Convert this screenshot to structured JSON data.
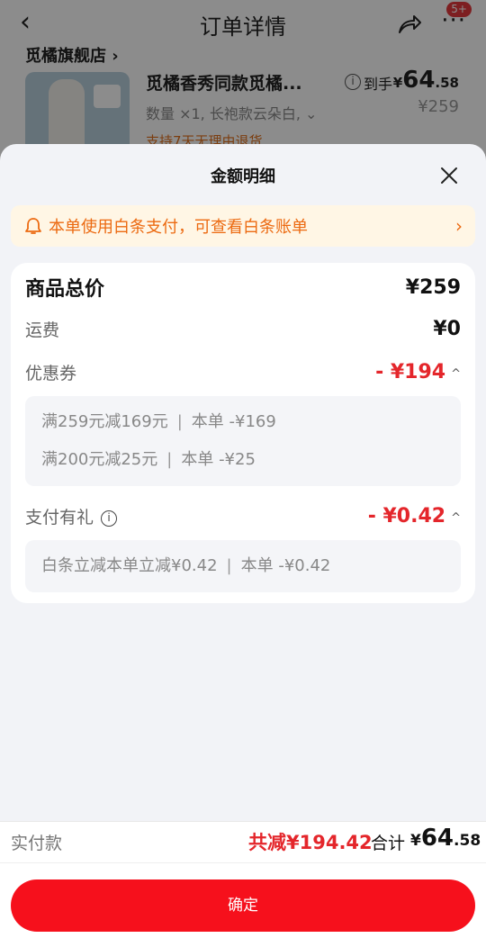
{
  "background": {
    "header_title": "订单详情",
    "back_glyph": "‹",
    "more_glyph": "···",
    "badge": "5+",
    "store_name": "觅橘旗舰店 ›",
    "product_name": "觅橘香秀同款觅橘...",
    "product_spec": "数量 ×1, 长袍款云朵白, ⌄",
    "policy": "支持7天无理由退货",
    "price_label": "到手",
    "price_currency": "¥",
    "price_int": "64",
    "price_dec": ".58",
    "original_price": "¥259"
  },
  "sheet": {
    "title": "金额明细",
    "notice": "本单使用白条支付，可查看白条账单",
    "notice_chevron": "›",
    "rows": {
      "goods_total_label": "商品总价",
      "goods_total_value": "¥259",
      "shipping_label": "运费",
      "shipping_value": "¥0",
      "coupon_label": "优惠券",
      "coupon_value": "- ¥194",
      "payment_gift_label": "支付有礼",
      "payment_gift_value": "- ¥0.42"
    },
    "coupon_details": [
      {
        "rule": "满259元减169元",
        "sep": "|",
        "amount": "本单 -¥169"
      },
      {
        "rule": "满200元减25元",
        "sep": "|",
        "amount": "本单 -¥25"
      }
    ],
    "gift_details": [
      {
        "rule": "白条立减本单立减¥0.42",
        "sep": "|",
        "amount": "本单 -¥0.42"
      }
    ]
  },
  "footer": {
    "pay_label": "实付款",
    "total_discount": "共减¥194.42",
    "total_label": "合计",
    "total_currency": "¥",
    "total_int": "64",
    "total_dec": ".58",
    "confirm_label": "确定"
  },
  "colors": {
    "accent_red": "#e4262b",
    "button_red": "#f6101c",
    "notice_orange": "#ec6a11",
    "notice_bg": "#fff6e5"
  },
  "icons": [
    "back-icon",
    "share-icon",
    "more-icon",
    "info-icon",
    "close-icon",
    "bell-icon",
    "chevron-right-icon",
    "caret-up-icon"
  ]
}
